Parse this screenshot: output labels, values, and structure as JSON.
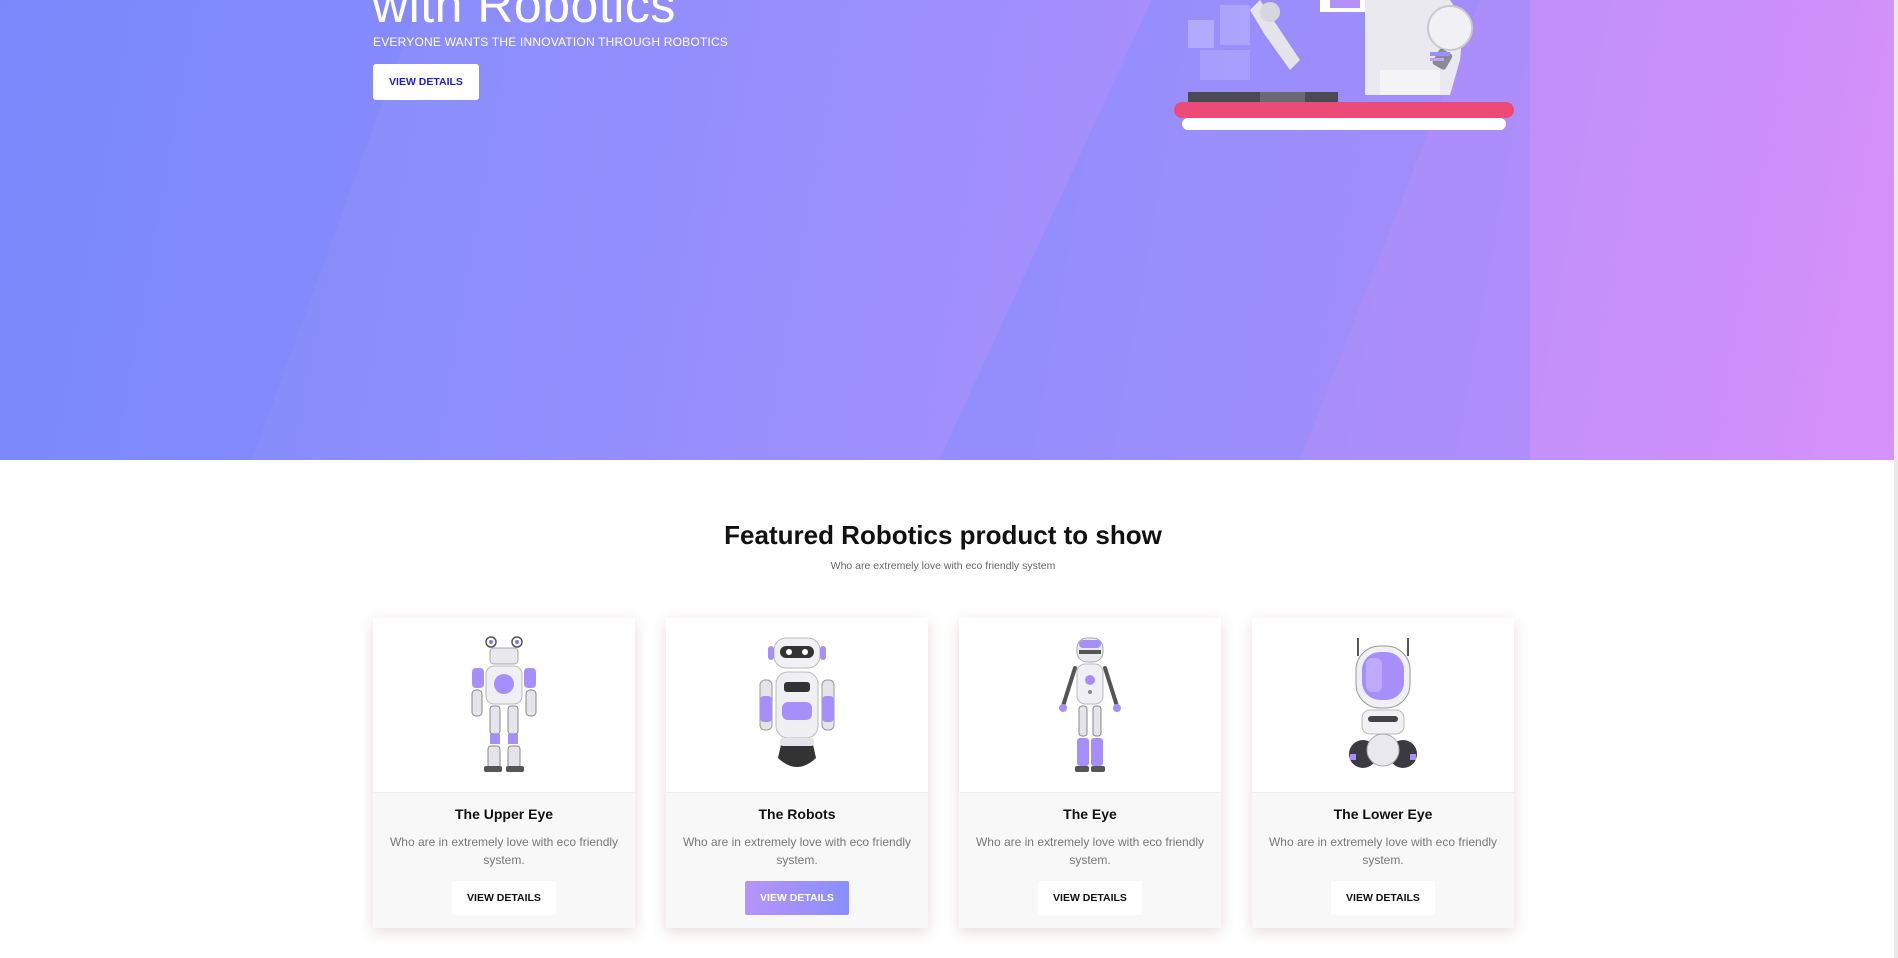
{
  "hero": {
    "title": "with Robotics",
    "subtitle": "EVERYONE WANTS THE INNOVATION THROUGH ROBOTICS",
    "button_label": "VIEW DETAILS"
  },
  "featured": {
    "title": "Featured Robotics product to show",
    "subtitle": "Who are extremely love with eco friendly system"
  },
  "products": [
    {
      "name": "The Upper Eye",
      "description": "Who are in extremely love with eco friendly system.",
      "button_label": "VIEW DETAILS",
      "active": false
    },
    {
      "name": "The Robots",
      "description": "Who are in extremely love with eco friendly system.",
      "button_label": "VIEW DETAILS",
      "active": true
    },
    {
      "name": "The Eye",
      "description": "Who are in extremely love with eco friendly system.",
      "button_label": "VIEW DETAILS",
      "active": false
    },
    {
      "name": "The Lower Eye",
      "description": "Who are in extremely love with eco friendly system.",
      "button_label": "VIEW DETAILS",
      "active": false
    }
  ],
  "colors": {
    "hero_gradient_start": "#7c8cfc",
    "hero_gradient_end": "#d690f9",
    "accent_purple": "#a98ffb",
    "hero_button_text": "#1d1dd6"
  }
}
